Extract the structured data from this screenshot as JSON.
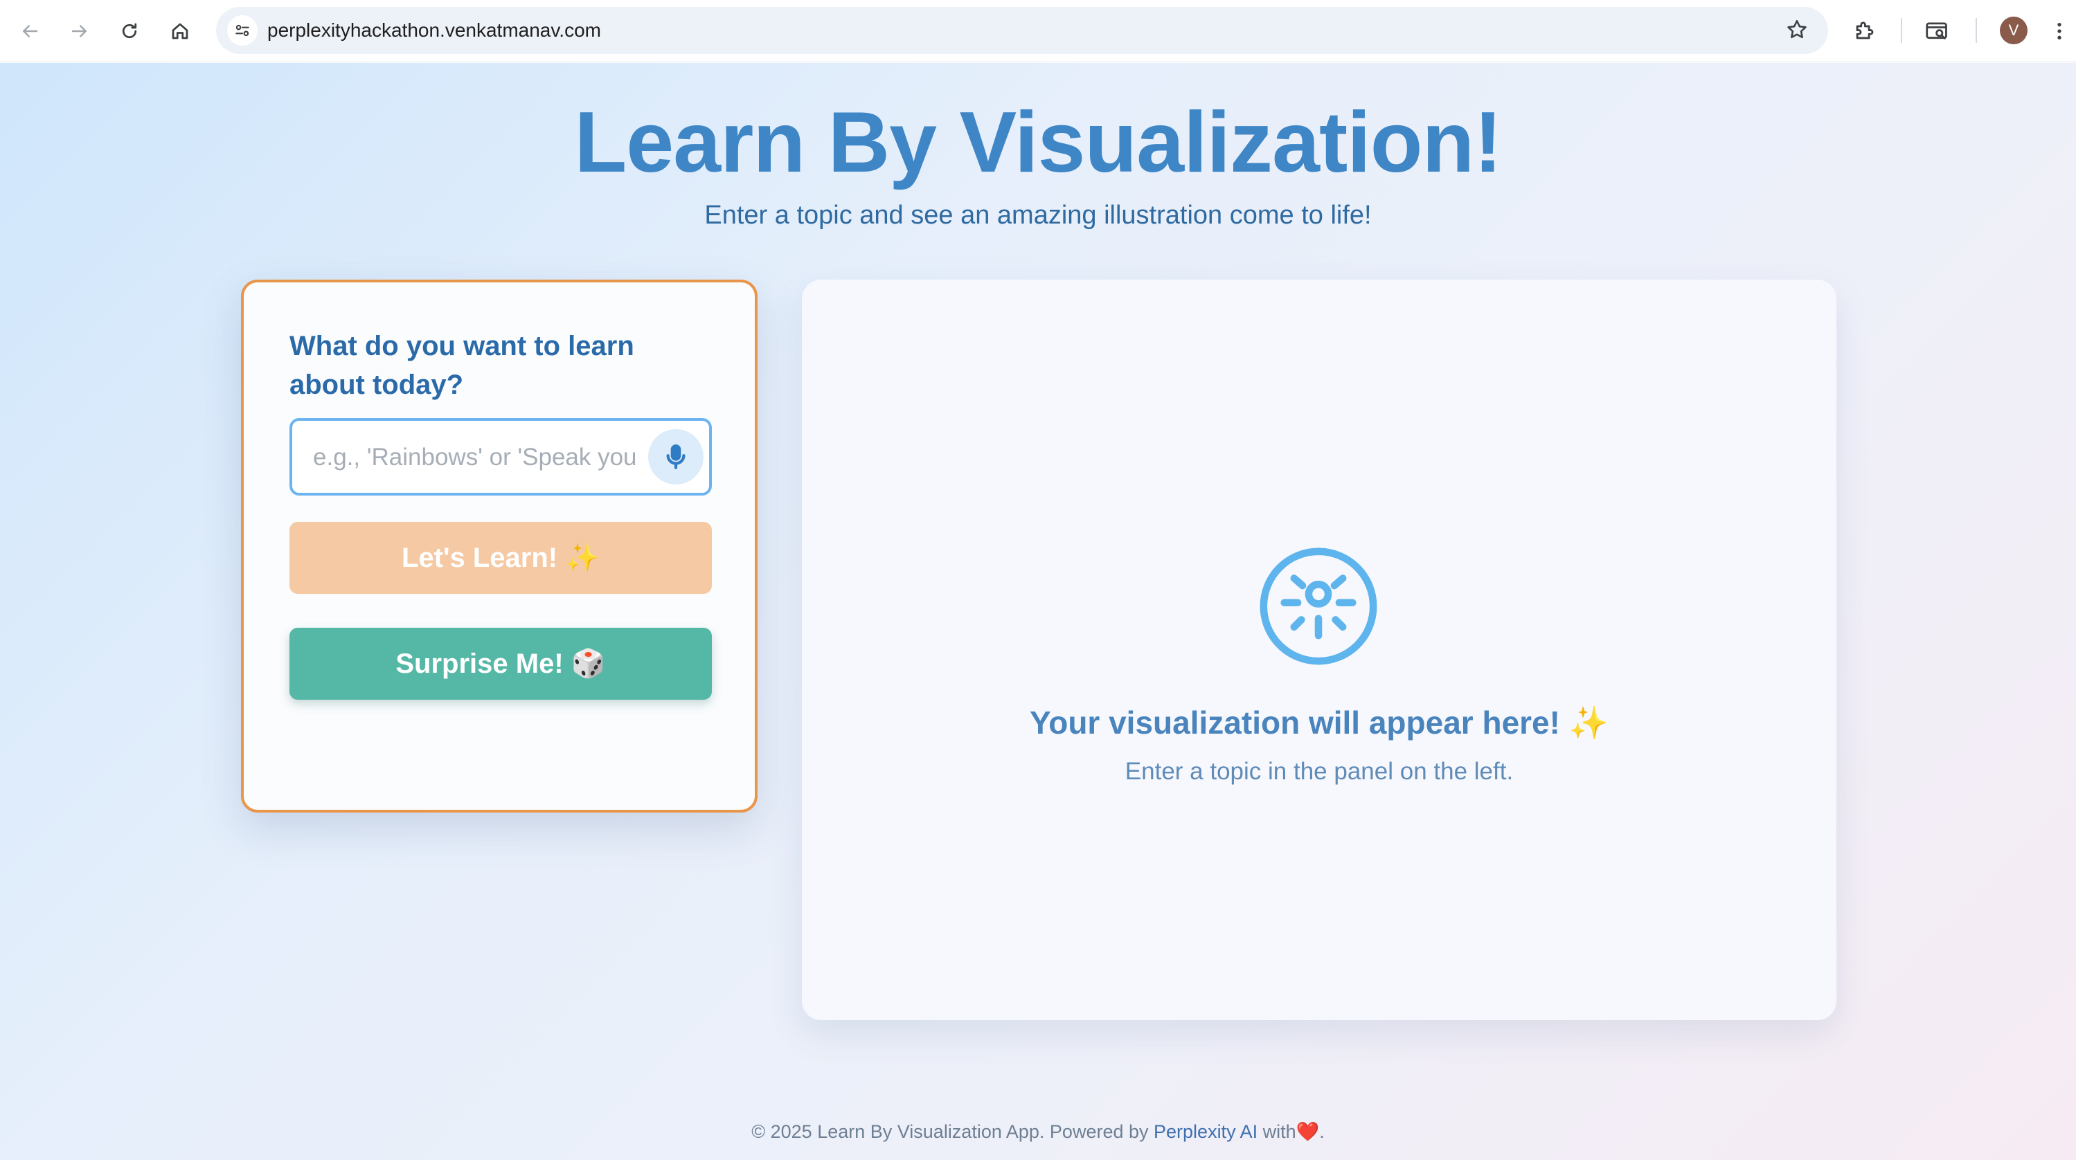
{
  "browser": {
    "url": "perplexityhackathon.venkatmanav.com",
    "avatar_letter": "V",
    "icons": {
      "back": "arrow-left-icon",
      "forward": "arrow-right-icon",
      "reload": "reload-icon",
      "home": "home-icon",
      "site_settings": "tune-icon",
      "bookmark": "star-icon",
      "extensions": "puzzle-icon",
      "tab_search": "tab-search-icon",
      "menu": "kebab-menu-icon"
    }
  },
  "header": {
    "title": "Learn By Visualization!",
    "subtitle": "Enter a topic and see an amazing illustration come to life!",
    "title_color": "#3f86c6"
  },
  "input_panel": {
    "question": "What do you want to learn about today?",
    "topic_input": {
      "placeholder": "e.g., 'Rainbows' or 'Speak your topic'",
      "value": ""
    },
    "mic_icon": "microphone-icon",
    "learn_button": {
      "label": "Let's Learn!",
      "emoji": "✨",
      "color": "#f4c9a4"
    },
    "surprise_button": {
      "label": "Surprise Me!",
      "emoji": "🎲",
      "color": "#55b7a5"
    },
    "border_color": "#e9954a"
  },
  "viz_panel": {
    "icon": "lightbulb-sun-icon",
    "heading": "Your visualization will appear here!",
    "heading_emoji": "✨",
    "subtext": "Enter a topic in the panel on the left."
  },
  "footer": {
    "text_before": "© 2025 Learn By Visualization App. Powered by",
    "link": "Perplexity AI",
    "text_after": "with",
    "heart": "❤️",
    "end": "."
  }
}
